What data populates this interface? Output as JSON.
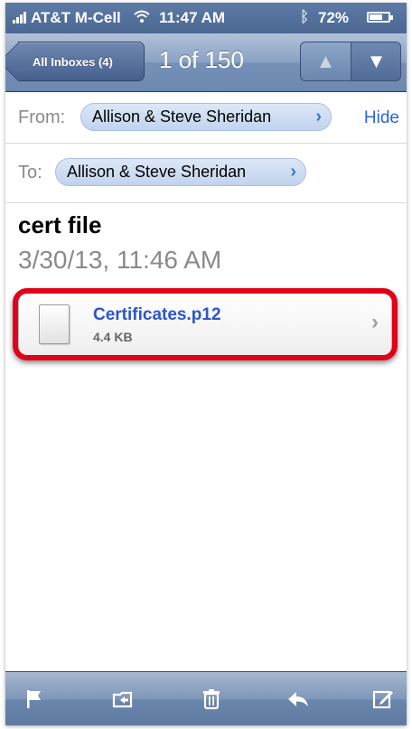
{
  "status_bar": {
    "carrier": "AT&T M-Cell",
    "time": "11:47 AM",
    "battery_percent": "72%",
    "battery_level": 0.72
  },
  "nav_bar": {
    "back_label": "All Inboxes (4)",
    "title": "1 of 150",
    "up_icon": "up-arrow-icon",
    "down_icon": "down-arrow-icon"
  },
  "header": {
    "from_label": "From:",
    "from_value": "Allison & Steve Sheridan",
    "hide_label": "Hide",
    "to_label": "To:",
    "to_value": "Allison & Steve Sheridan"
  },
  "message": {
    "subject": "cert file",
    "date": "3/30/13, 11:46 AM"
  },
  "attachment": {
    "filename": "Certificates.p12",
    "size": "4.4 KB",
    "icon": "document-icon",
    "highlight_color": "#e0001a"
  },
  "toolbar": {
    "icons": [
      "flag-icon",
      "move-folder-icon",
      "trash-icon",
      "reply-icon",
      "compose-icon"
    ]
  },
  "colors": {
    "navbar": "#7591b7",
    "link": "#2b65d9",
    "attachment_name": "#2b56c9"
  }
}
